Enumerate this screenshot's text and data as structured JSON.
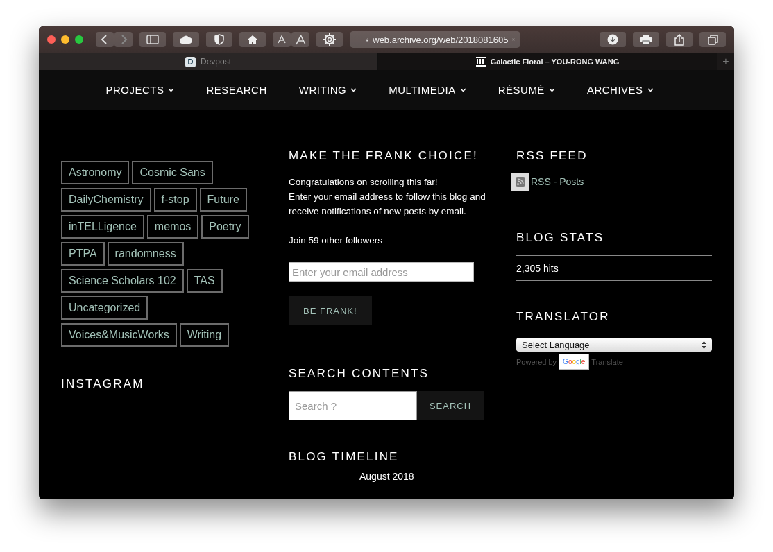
{
  "browser": {
    "address": "web.archive.org/web/2018081605",
    "new_tab": "+",
    "tabs": [
      {
        "title": "Devpost",
        "selected": false,
        "kind": "letter",
        "icon_text": "D"
      },
      {
        "title": "Galactic Floral – YOU-RONG WANG",
        "selected": true,
        "kind": "columns"
      }
    ]
  },
  "nav": [
    {
      "label": "PROJECTS",
      "dropdown": true
    },
    {
      "label": "RESEARCH",
      "dropdown": false
    },
    {
      "label": "WRITING",
      "dropdown": true
    },
    {
      "label": "MULTIMEDIA",
      "dropdown": true
    },
    {
      "label": "RÉSUMÉ",
      "dropdown": true
    },
    {
      "label": "ARCHIVES",
      "dropdown": true
    }
  ],
  "tags": [
    "Astronomy",
    "Cosmic Sans",
    "DailyChemistry",
    "f-stop",
    "Future",
    "inTELLigence",
    "memos",
    "Poetry",
    "PTPA",
    "randomness",
    "Science Scholars 102",
    "TAS",
    "Uncategorized",
    "Voices&MusicWorks",
    "Writing"
  ],
  "instagram": {
    "title": "INSTAGRAM"
  },
  "subscribe": {
    "title": "MAKE THE FRANK CHOICE!",
    "lines": [
      "Congratulations on scrolling this far!",
      "Enter your email address to follow this blog and receive notifications of new posts by email."
    ],
    "followers": "Join 59 other followers",
    "email_placeholder": "Enter your email address",
    "button": "BE FRANK!"
  },
  "search": {
    "title": "SEARCH CONTENTS",
    "placeholder": "Search ?",
    "button": "SEARCH"
  },
  "timeline": {
    "title": "BLOG TIMELINE",
    "items": [
      "August 2018"
    ]
  },
  "rss": {
    "title": "RSS FEED",
    "link": "RSS - Posts"
  },
  "stats": {
    "title": "BLOG STATS",
    "hits": "2,305 hits"
  },
  "translator": {
    "title": "TRANSLATOR",
    "select": "Select Language",
    "powered_by": "Powered by",
    "google": "Google",
    "translate": "Translate"
  }
}
